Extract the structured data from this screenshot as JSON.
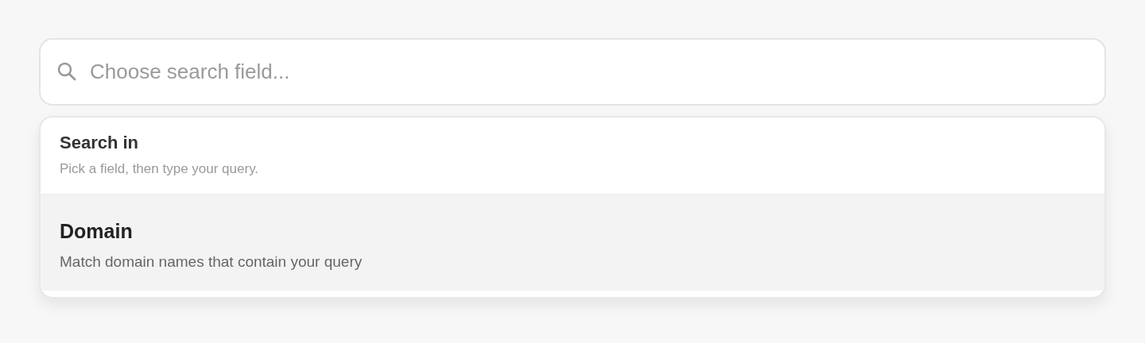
{
  "search": {
    "placeholder": "Choose search field..."
  },
  "dropdown": {
    "heading": "Search in",
    "hint": "Pick a field, then type your query.",
    "options": [
      {
        "label": "Domain",
        "description": "Match domain names that contain your query",
        "selected": true
      }
    ]
  }
}
